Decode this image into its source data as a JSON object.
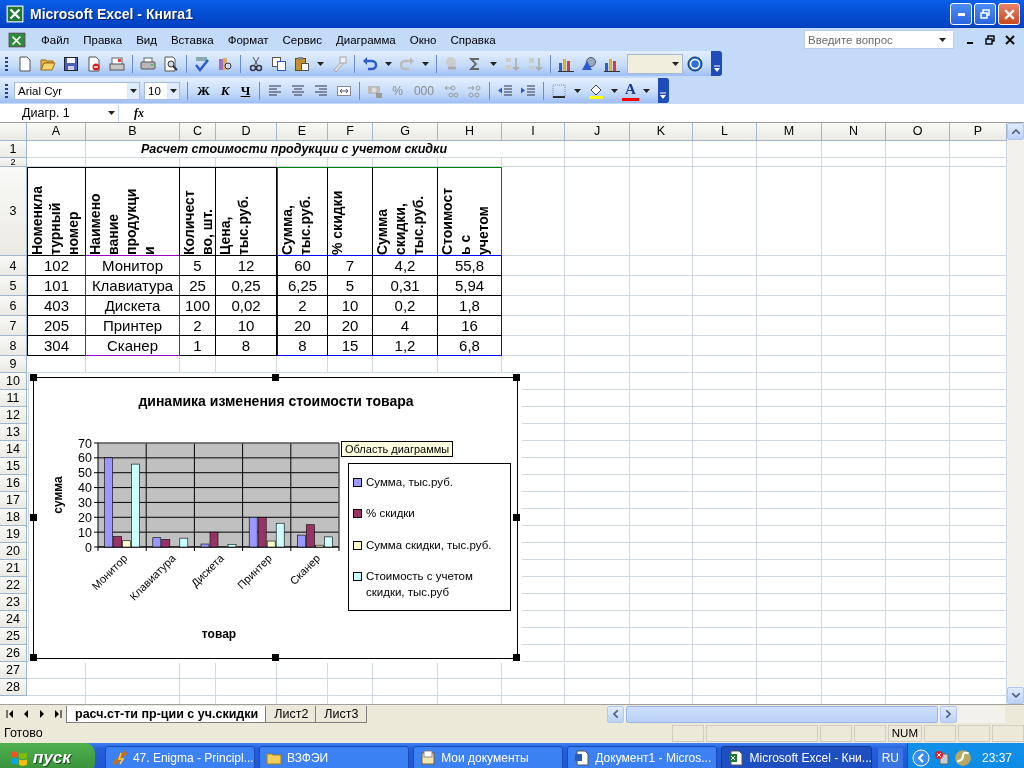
{
  "window": {
    "title": "Microsoft Excel - Книга1"
  },
  "menu": [
    "Файл",
    "Правка",
    "Вид",
    "Вставка",
    "Формат",
    "Сервис",
    "Диаграмма",
    "Окно",
    "Справка"
  ],
  "help_search": {
    "placeholder": "Введите вопрос"
  },
  "formatting": {
    "font": "Arial Cyr",
    "size": "10",
    "style_buttons": [
      "Ж",
      "К",
      "Ч"
    ],
    "number_buttons": [
      "%",
      "000"
    ],
    "font_color_label": "A"
  },
  "formula_bar": {
    "name_box": "Диагр. 1",
    "function_label": "fx"
  },
  "sheet": {
    "columns": [
      "A",
      "B",
      "C",
      "D",
      "E",
      "F",
      "G",
      "H",
      "I",
      "J",
      "K",
      "L",
      "M",
      "N",
      "O",
      "P"
    ],
    "rows": [
      "1",
      "2",
      "3",
      "4",
      "5",
      "6",
      "7",
      "8",
      "9",
      "10",
      "11",
      "12",
      "13",
      "14",
      "15",
      "16",
      "17",
      "18",
      "19",
      "20",
      "21",
      "22",
      "23",
      "24",
      "25",
      "26",
      "27",
      "28"
    ],
    "title": "Расчет стоимости продукции с учетом скидки",
    "table": {
      "header": [
        "Номенкла\nтурный\nномер",
        "Наимено\nвание\nпродукци\nи",
        "Количест\nво, шт.",
        "Цена,\nтыс.руб.",
        "Сумма,\nтыс.руб.",
        "% скидки",
        "Сумма\nскидки,\nтыс.руб.",
        "Стоимост\nь с\nучетом"
      ],
      "rows": [
        [
          "102",
          "Монитор",
          "5",
          "12",
          "60",
          "7",
          "4,2",
          "55,8"
        ],
        [
          "101",
          "Клавиатура",
          "25",
          "0,25",
          "6,25",
          "5",
          "0,31",
          "5,94"
        ],
        [
          "403",
          "Дискета",
          "100",
          "0,02",
          "2",
          "10",
          "0,2",
          "1,8"
        ],
        [
          "205",
          "Принтер",
          "2",
          "10",
          "20",
          "20",
          "4",
          "16"
        ],
        [
          "304",
          "Сканер",
          "1",
          "8",
          "8",
          "15",
          "1,2",
          "6,8"
        ]
      ]
    },
    "chart": {
      "tooltip": "Область диаграммы",
      "chart_data": {
        "type": "bar",
        "title": "динамика изменения стоимости товара",
        "xlabel": "товар",
        "ylabel": "сумма",
        "categories": [
          "Монитор",
          "Клавиатура",
          "Дискета",
          "Принтер",
          "Сканер"
        ],
        "series": [
          {
            "name": "Сумма, тыс.руб.",
            "color": "#9999ff",
            "values": [
              60,
              6.25,
              2,
              20,
              8
            ]
          },
          {
            "name": "% скидки",
            "color": "#993366",
            "values": [
              7,
              5,
              10,
              20,
              15
            ]
          },
          {
            "name": "Сумма скидки, тыс.руб.",
            "color": "#ffffcc",
            "values": [
              4.2,
              null,
              null,
              4,
              1.2
            ]
          },
          {
            "name": "Стоимость с учетом скидки, тыс.руб",
            "color": "#ccffff",
            "values": [
              55.8,
              5.94,
              1.8,
              16,
              6.8
            ]
          }
        ],
        "ylim": [
          0,
          70
        ],
        "yticks": [
          0,
          10,
          20,
          30,
          40,
          50,
          60,
          70
        ],
        "grid": true,
        "legend": true
      }
    }
  },
  "sheet_tabs": [
    {
      "label": "расч.ст-ти пр-ции с уч.скидки",
      "selected": true
    },
    {
      "label": "Лист2",
      "selected": false
    },
    {
      "label": "Лист3",
      "selected": false
    }
  ],
  "status_bar": {
    "text": "Готово",
    "indicator": "NUM"
  },
  "taskbar": {
    "start": "пуск",
    "tasks": [
      {
        "label": "47. Enigma - Principl...",
        "kind": "player",
        "selected": false
      },
      {
        "label": "ВЗФЭИ",
        "kind": "folder",
        "selected": false
      },
      {
        "label": "Мои документы",
        "kind": "documents",
        "selected": false
      },
      {
        "label": "Документ1 - Micros...",
        "kind": "word",
        "selected": false
      },
      {
        "label": "Microsoft Excel - Кни...",
        "kind": "excel",
        "selected": true
      }
    ],
    "language": "RU",
    "clock": "23:37"
  }
}
